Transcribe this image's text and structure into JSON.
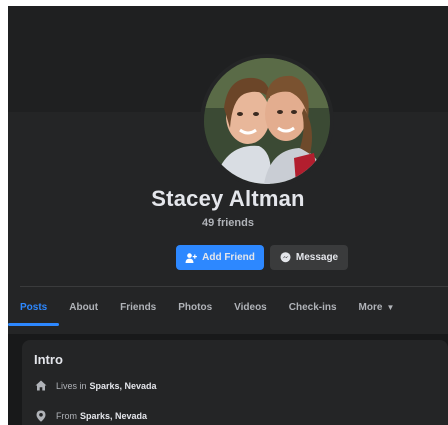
{
  "profile": {
    "name": "Stacey Altman",
    "friends": "49 friends"
  },
  "actions": {
    "add_friend": "Add Friend",
    "message": "Message"
  },
  "tabs": [
    {
      "label": "Posts",
      "active": true
    },
    {
      "label": "About",
      "active": false
    },
    {
      "label": "Friends",
      "active": false
    },
    {
      "label": "Photos",
      "active": false
    },
    {
      "label": "Videos",
      "active": false
    },
    {
      "label": "Check-ins",
      "active": false
    },
    {
      "label": "More",
      "active": false
    }
  ],
  "intro": {
    "title": "Intro",
    "lives_prefix": "Lives in",
    "lives_place": "Sparks, Nevada",
    "from_prefix": "From",
    "from_place": "Sparks, Nevada"
  },
  "icons": {
    "add_friend": "person-plus-icon",
    "message": "messenger-icon",
    "more": "caret-down-icon",
    "lives": "home-icon",
    "from": "location-pin-icon"
  },
  "colors": {
    "accent": "#2d88ff",
    "background": "#18191a",
    "panel": "#242526",
    "text_primary": "#e4e6eb",
    "text_secondary": "#b0b3b8"
  }
}
